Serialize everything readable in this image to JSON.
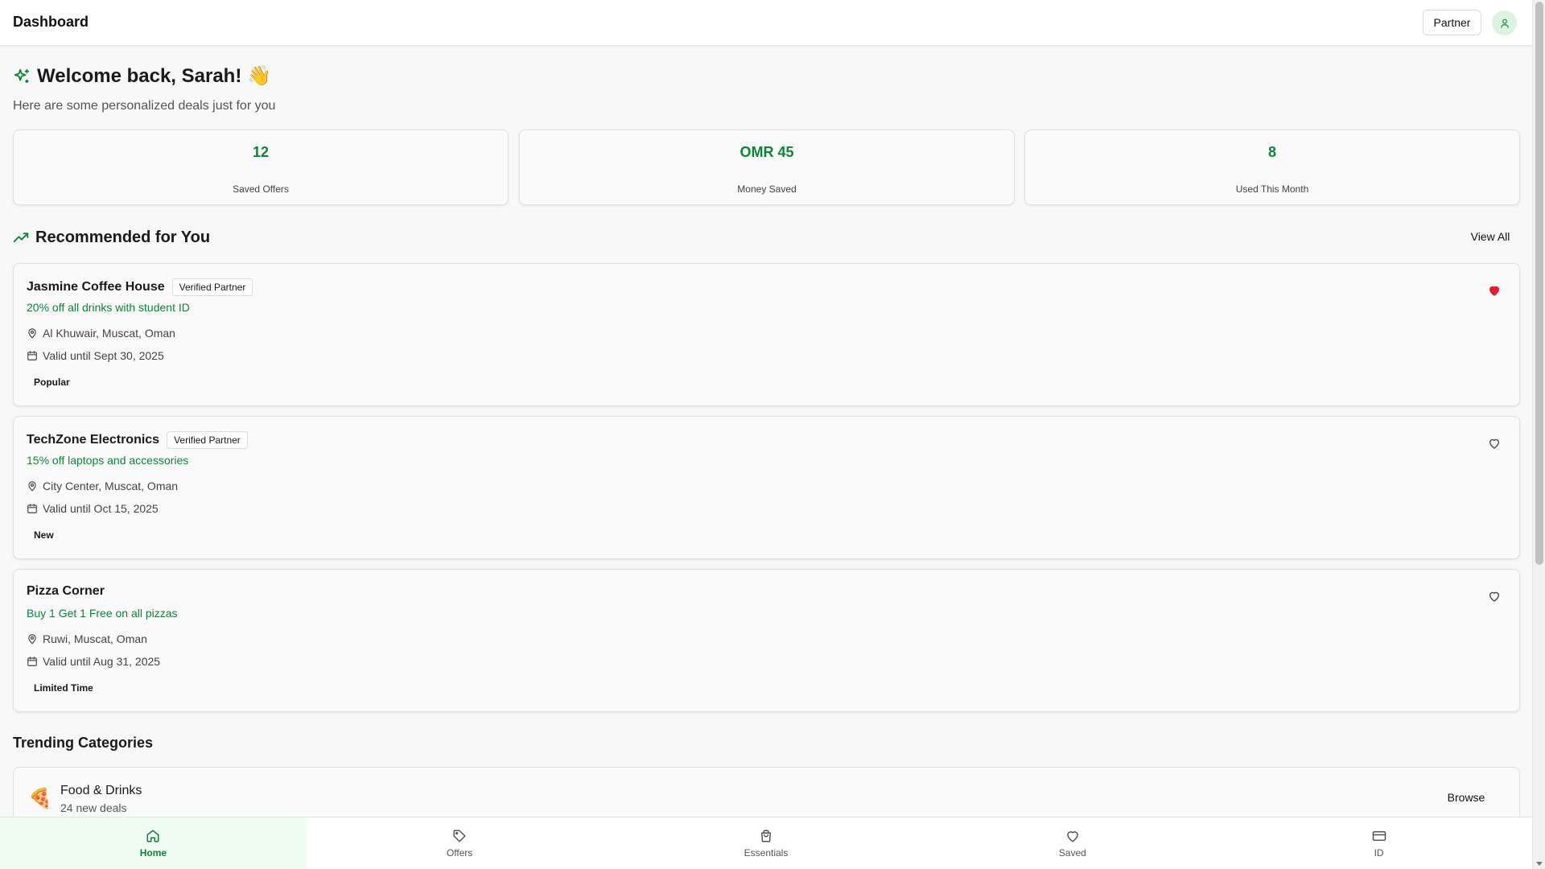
{
  "header": {
    "title": "Dashboard",
    "partner_label": "Partner"
  },
  "welcome": {
    "heading": "Welcome back, Sarah! 👋",
    "subtitle": "Here are some personalized deals just for you"
  },
  "stats": [
    {
      "value": "12",
      "label": "Saved Offers"
    },
    {
      "value": "OMR 45",
      "label": "Money Saved"
    },
    {
      "value": "8",
      "label": "Used This Month"
    }
  ],
  "recommended": {
    "title": "Recommended for You",
    "view_all_label": "View All",
    "offers": [
      {
        "name": "Jasmine Coffee House",
        "verified_label": "Verified Partner",
        "deal": "20% off all drinks with student ID",
        "location": "Al Khuwair, Muscat, Oman",
        "valid": "Valid until Sept 30, 2025",
        "tag": "Popular",
        "saved": true
      },
      {
        "name": "TechZone Electronics",
        "verified_label": "Verified Partner",
        "deal": "15% off laptops and accessories",
        "location": "City Center, Muscat, Oman",
        "valid": "Valid until Oct 15, 2025",
        "tag": "New",
        "saved": false
      },
      {
        "name": "Pizza Corner",
        "verified_label": "",
        "deal": "Buy 1 Get 1 Free on all pizzas",
        "location": "Ruwi, Muscat, Oman",
        "valid": "Valid until Aug 31, 2025",
        "tag": "Limited Time",
        "saved": false
      }
    ]
  },
  "trending": {
    "title": "Trending Categories",
    "categories": [
      {
        "emoji": "🍕",
        "name": "Food & Drinks",
        "count": "24 new deals",
        "browse_label": "Browse"
      }
    ]
  },
  "bottom_nav": [
    {
      "label": "Home",
      "icon": "home-icon",
      "active": true
    },
    {
      "label": "Offers",
      "icon": "tag-icon",
      "active": false
    },
    {
      "label": "Essentials",
      "icon": "shopping-bag-icon",
      "active": false
    },
    {
      "label": "Saved",
      "icon": "heart-icon",
      "active": false
    },
    {
      "label": "ID",
      "icon": "id-card-icon",
      "active": false
    }
  ],
  "colors": {
    "accent": "#15803d",
    "heart_filled": "#e11d2e",
    "active_nav_bg": "#eefbf1"
  }
}
